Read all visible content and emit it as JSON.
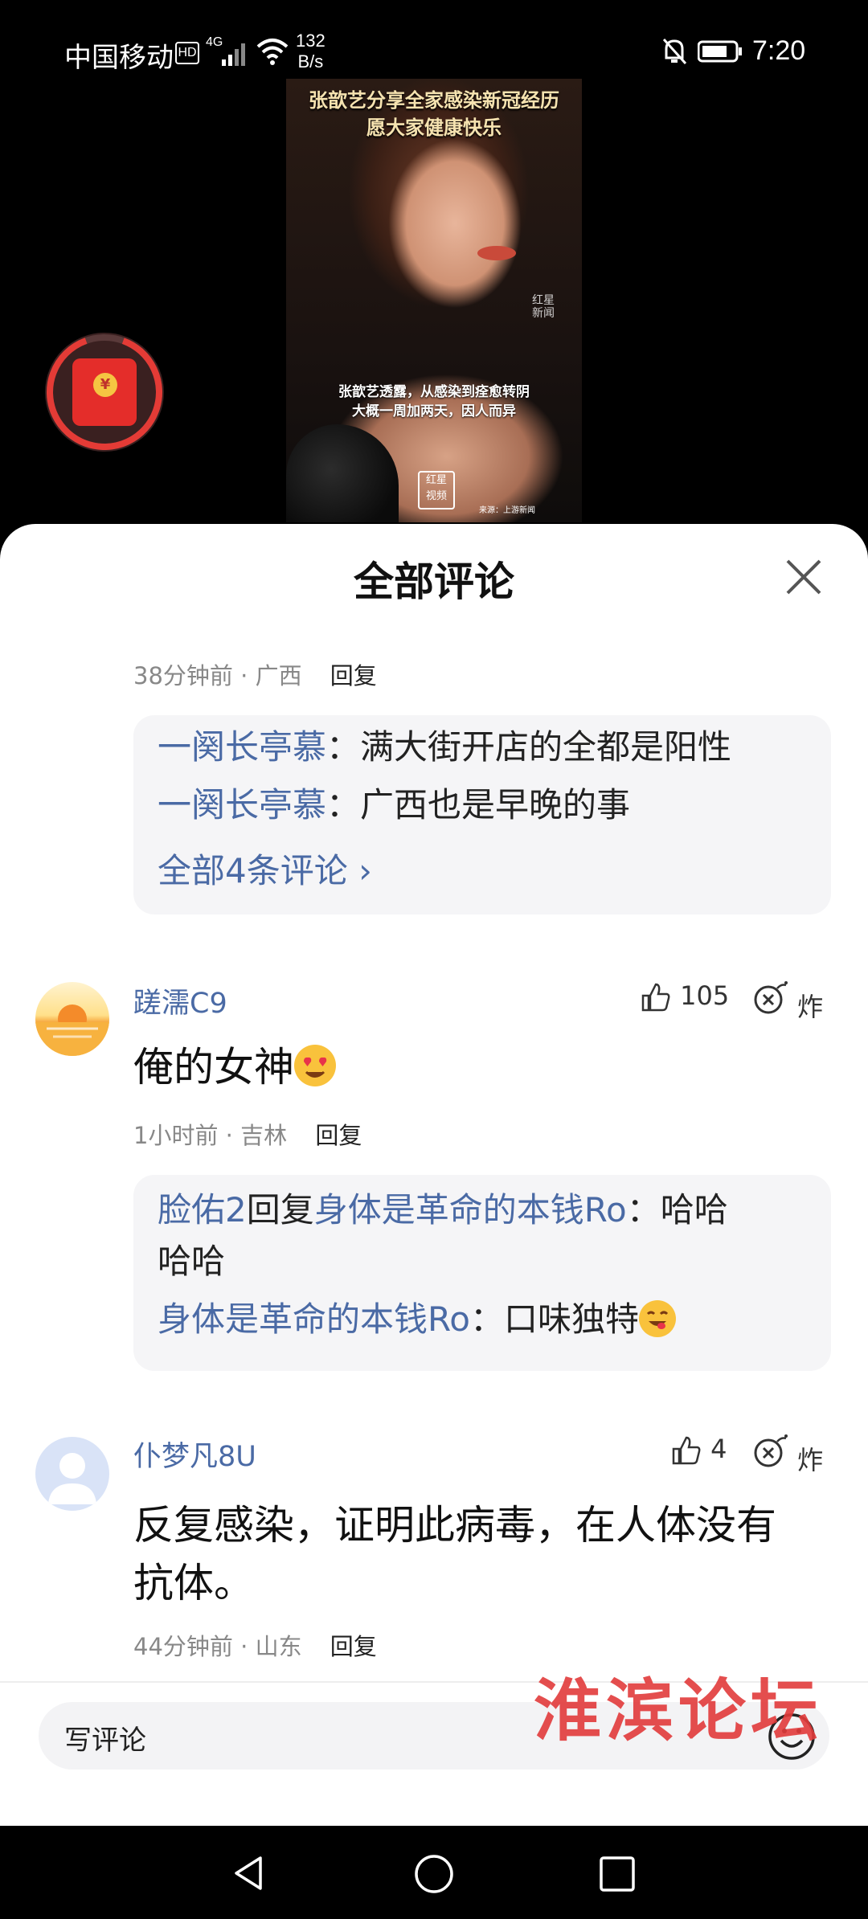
{
  "status_bar": {
    "carrier": "中国移动",
    "hd": "HD",
    "network": "4G",
    "speed_value": "132",
    "speed_unit": "B/s",
    "time": "7:20"
  },
  "video": {
    "title_line1": "张歆艺分享全家感染新冠经历",
    "title_line2": "愿大家健康快乐",
    "subtitle_line1": "张歆艺透露，从感染到痊愈转阴",
    "subtitle_line2": "大概一周加两天，因人而异",
    "watermark_line1": "红星",
    "watermark_line2": "新闻",
    "logo_line1": "红星",
    "logo_line2": "视频",
    "source": "来源：上游新闻"
  },
  "red_envelope": {
    "symbol": "¥"
  },
  "sheet": {
    "title": "全部评论"
  },
  "comments": [
    {
      "time": "38分钟前",
      "location": "广西",
      "reply_label": "回复",
      "replies": [
        {
          "user": "一阕长亭慕",
          "text": "满大街开店的全都是阳性"
        },
        {
          "user": "一阕长亭慕",
          "text": "广西也是早晚的事"
        }
      ],
      "more": "全部4条评论 ›"
    },
    {
      "username": "蹉濡C9",
      "likes": "105",
      "bomb": "炸",
      "text": "俺的女神",
      "time": "1小时前",
      "location": "吉林",
      "reply_label": "回复",
      "replies": [
        {
          "user": "脸佑2",
          "mid": "回复",
          "target": "身体是革命的本钱Ro",
          "text": "哈哈",
          "text2": "哈哈"
        },
        {
          "user": "身体是革命的本钱Ro",
          "text": "口味独特"
        }
      ]
    },
    {
      "username": "仆梦凡8U",
      "likes": "4",
      "bomb": "炸",
      "text_line1": "反复感染，证明此病毒，在人体没有",
      "text_line2": "抗体。",
      "time": "44分钟前",
      "location": "山东",
      "reply_label": "回复"
    }
  ],
  "input": {
    "placeholder": "写评论"
  },
  "watermark": "淮滨论坛",
  "colors": {
    "link": "#4a6aa5",
    "accent_red": "#e42d2a",
    "reply_bg": "#f5f5f7"
  }
}
